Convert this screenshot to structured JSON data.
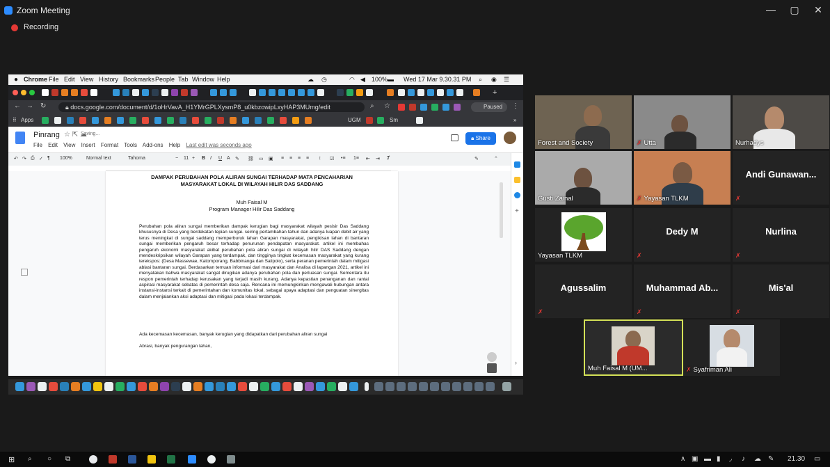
{
  "zoom": {
    "window_title": "Zoom Meeting",
    "recording_label": "Recording",
    "controls": {
      "minimize": "—",
      "maximize": "▢",
      "close": "✕"
    }
  },
  "mac_menubar": {
    "app": "Chrome",
    "menus": [
      "File",
      "Edit",
      "View",
      "History",
      "Bookmarks",
      "People",
      "Tab",
      "Window",
      "Help"
    ],
    "battery": "100%",
    "clock": "Wed 17 Mar 9.30.31 PM"
  },
  "chrome": {
    "url": "docs.google.com/document/d/1oHrVavA_H1YMrGPLXysmP8_u0kbzowipLxyHAP3MUmg/edit",
    "paused_label": "Paused",
    "bookmarks": {
      "apps": "Apps",
      "ugm": "UGM",
      "sm": "Sm"
    }
  },
  "docs": {
    "doc_name": "Pinrang",
    "saving": "Saving...",
    "menus": [
      "File",
      "Edit",
      "View",
      "Insert",
      "Format",
      "Tools",
      "Add-ons",
      "Help"
    ],
    "last_edit": "Last edit was seconds ago",
    "share_label": "Share",
    "toolbar": {
      "zoom": "100%",
      "style": "Normal text",
      "font": "Tahoma",
      "size": "11"
    },
    "title_line1": "DAMPAK PERUBAHAN POLA ALIRAN SUNGAI TERHADAP MATA PENCAHARIAN",
    "title_line2": "MASYARAKAT LOKAL DI WILAYAH HILIR DAS SADDANG",
    "author": "Muh Faisal M",
    "author_role": "Program Manager Hilir Das Saddang",
    "body": "Perubahan pola aliran sungai memberikan dampak kerugian bagi masyarakat wilayah pesisir Das Saddang khususnya di Desa yang berdekatan tepian sungai. seiring pertambahan tahun dan adanya luapan debit air yang terus meningkat di sungai saddang memperburuk lahan Garapan masyarakat, pengikisan lahan di bantaran sungai memberikan pengaruh besar terhadap penurunan pendapatan masyarakat. artikel ini membahas pengaruh ekonomi masyarakat akibat perubahan pola aliran sungai di wilayah hilir DAS Saddang dengan mendeskripsikan wilayah Garapan yang terdampak, dan tingginya tingkat kecemasan masyarakat yang kurang terekspos: (Desa Massewae, Katomporang, Babbinanga dan Salipolo), serta peranan pemerintah dalam mitigasi ablasi bantaran sungai. Berdasarkan temuan informasi dari masyarakat dan Analisa di lapangan 2021, artikel ini menyatakan bahwa masyarakat sangat dirugikan adanya perubahan pola dan perluasan sungai. Sementara itu respon pemerintah terhadap kerusakan yang terjadi masih kurang. Adanya kepastian penanganan dan rantai aspirasi masyarakat sebatas di pemerintah desa saja. Rencana ini memungkinkan mengawali hubungan antara instansi-instansi terkait di pemerintahan dan komunitas lokal, sebagai upaya adaptasi dan penguatan sinergitas dalam menjalankan aksi adaptasi dan mitigasi pada lokasi terdampak.",
    "para2": "Ada kecemasan kecemasan, banyak kerugian yang didapatkan dari perubahan aliran sungai",
    "para3": "Abrasi, banyak pengurangan lahan,"
  },
  "participants": [
    {
      "name": "Forest and Society",
      "video": true,
      "muted": false
    },
    {
      "name": "Utta",
      "video": true,
      "muted": true
    },
    {
      "name": "Nurhadys",
      "video": true,
      "muted": false
    },
    {
      "name": "Gusti Zainal",
      "video": true,
      "muted": false
    },
    {
      "name": "Yayasan TLKM",
      "video": true,
      "muted": true
    },
    {
      "name": "Andi Gunawan...",
      "video": false,
      "muted": true
    },
    {
      "name": "Yayasan TLKM",
      "video": true,
      "muted": false
    },
    {
      "name": "Dedy M",
      "video": false,
      "muted": true
    },
    {
      "name": "Nurlina",
      "video": false,
      "muted": true
    },
    {
      "name": "Agussalim",
      "video": false,
      "muted": true
    },
    {
      "name": "Muhammad Ab...",
      "video": false,
      "muted": true
    },
    {
      "name": "Mis'al",
      "video": false,
      "muted": true
    },
    {
      "name": "Muh Faisal M (UM...",
      "video": true,
      "muted": false,
      "active": true
    },
    {
      "name": "Syafriman Ali",
      "video": true,
      "muted": true
    }
  ],
  "taskbar": {
    "clock": "21.30"
  },
  "colors": {
    "zoom_bg": "#1a1a1a",
    "recording_red": "#e53935",
    "active_speaker": "#d4e157",
    "share_blue": "#1a73e8"
  }
}
